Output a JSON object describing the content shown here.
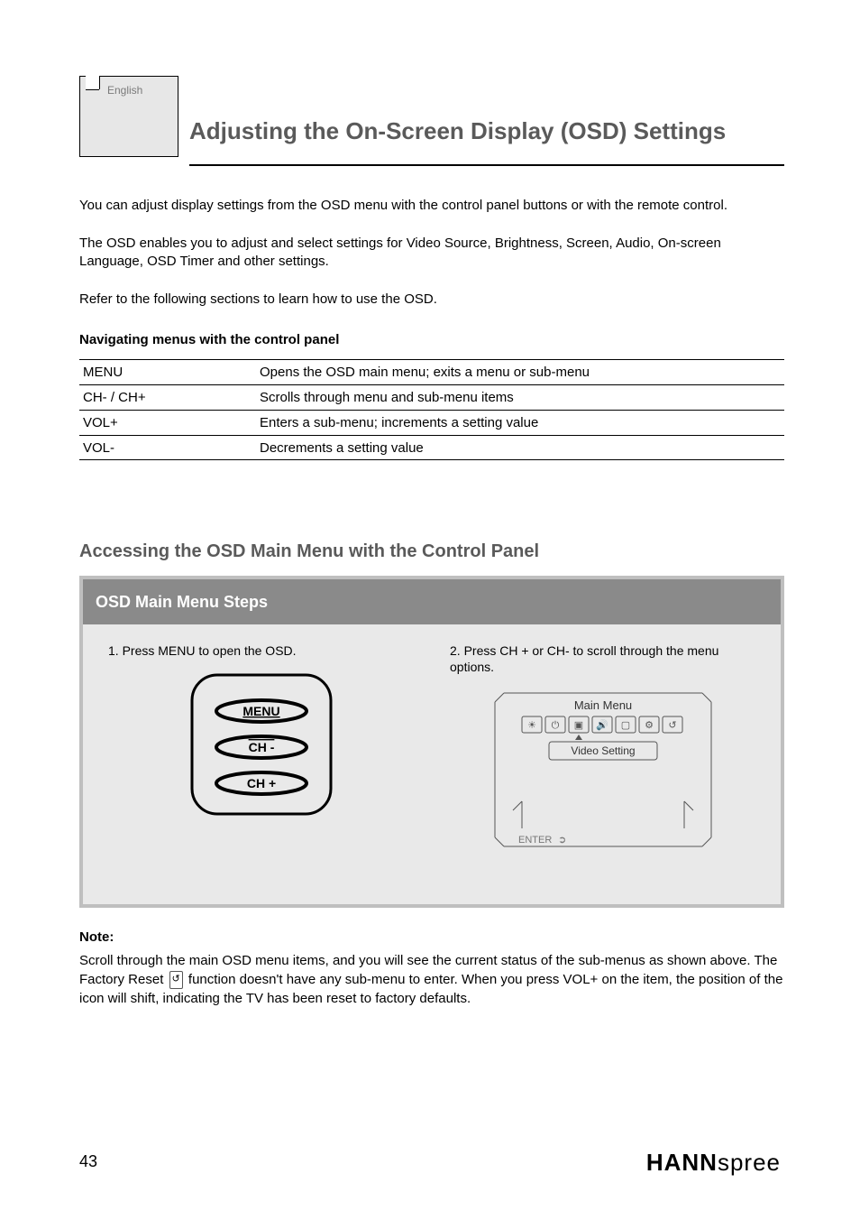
{
  "tab": {
    "label": "English"
  },
  "header": {
    "title": "Adjusting the On-Screen Display (OSD) Settings"
  },
  "paragraphs": {
    "p1": "You can adjust display settings from the OSD menu with the control panel buttons or with the remote control.",
    "p2": "The OSD enables you to adjust and select settings for Video Source, Brightness, Screen, Audio, On-screen Language, OSD Timer and other settings.",
    "p3": "Refer to the following sections to learn how to use the OSD."
  },
  "navTable": {
    "heading": "Navigating menus with the control panel",
    "rows": [
      {
        "btn": "MENU",
        "desc": "Opens the OSD main menu; exits a menu or sub-menu"
      },
      {
        "btn": "CH- / CH+",
        "desc": "Scrolls through menu and sub-menu items"
      },
      {
        "btn": "VOL+",
        "desc": "Enters a sub-menu; increments a setting value"
      },
      {
        "btn": "VOL-",
        "desc": "Decrements a setting value"
      }
    ]
  },
  "panel": {
    "heading": "Accessing the OSD Main Menu with the Control Panel",
    "titlebar": "OSD Main Menu Steps",
    "step1": "1. Press MENU to open the OSD.",
    "step2": "2. Press CH + or CH- to scroll through the menu options.",
    "remote": {
      "btnMenu": "MENU",
      "btnChMinus": "CH -",
      "btnChPlus": "CH +"
    },
    "osd": {
      "title": "Main Menu",
      "sub": "Video Setting",
      "enter": "ENTER"
    }
  },
  "note": {
    "heading": "Note:",
    "before": "Scroll through the main OSD menu items, and you will see the current status of the sub-menus as shown above. The Factory Reset ",
    "iconLabel": "↺",
    "after": " function doesn't have any sub-menu to enter. When you press VOL+ on the item, the position of the icon will shift, indicating the TV has been reset to factory defaults."
  },
  "footer": {
    "pageNum": "43",
    "logoBold": "HANN",
    "logoLight": "spree"
  }
}
